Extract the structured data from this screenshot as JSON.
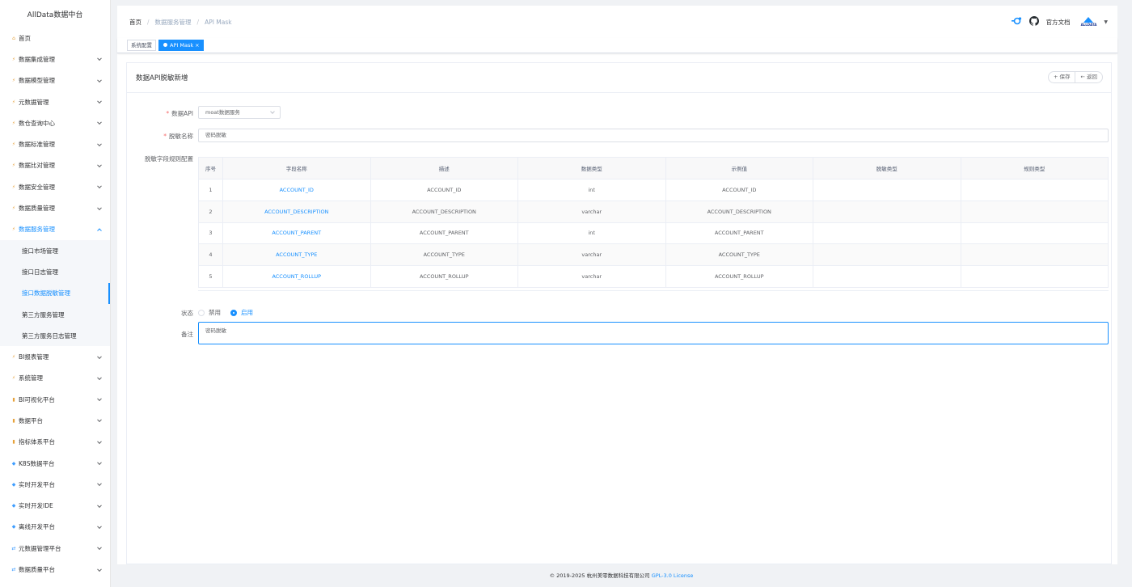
{
  "app_title": "AllData数据中台",
  "sidebar": {
    "items": [
      {
        "label": "首页",
        "icon": "home-icon",
        "expandable": false
      },
      {
        "label": "数据集成管理",
        "icon": "bolt-icon",
        "expandable": true
      },
      {
        "label": "数据模型管理",
        "icon": "bolt-icon",
        "expandable": true
      },
      {
        "label": "元数据管理",
        "icon": "bolt-icon",
        "expandable": true
      },
      {
        "label": "数仓查询中心",
        "icon": "bolt-icon",
        "expandable": true
      },
      {
        "label": "数据标准管理",
        "icon": "bolt-icon",
        "expandable": true
      },
      {
        "label": "数据比对管理",
        "icon": "bolt-icon",
        "expandable": true
      },
      {
        "label": "数据安全管理",
        "icon": "bolt-icon",
        "expandable": true
      },
      {
        "label": "数据质量管理",
        "icon": "bolt-icon",
        "expandable": true
      },
      {
        "label": "数据服务管理",
        "icon": "bolt-icon",
        "expandable": true,
        "open": true
      },
      {
        "label": "BI报表管理",
        "icon": "bolt-icon",
        "expandable": true
      },
      {
        "label": "系统管理",
        "icon": "bolt-icon",
        "expandable": true
      },
      {
        "label": "BI可视化平台",
        "icon": "chart-icon",
        "expandable": true
      },
      {
        "label": "数据平台",
        "icon": "chart-icon",
        "expandable": true
      },
      {
        "label": "指标体系平台",
        "icon": "chart-icon",
        "expandable": true
      },
      {
        "label": "K8S数据平台",
        "icon": "diamond-icon",
        "expandable": true
      },
      {
        "label": "实时开发平台",
        "icon": "diamond-icon",
        "expandable": true
      },
      {
        "label": "实时开发IDE",
        "icon": "diamond-icon",
        "expandable": true
      },
      {
        "label": "离线开发平台",
        "icon": "diamond-icon",
        "expandable": true
      },
      {
        "label": "元数据管理平台",
        "icon": "sync-icon",
        "expandable": true
      },
      {
        "label": "数据质量平台",
        "icon": "sync-icon",
        "expandable": true
      }
    ],
    "sub_items": [
      "接口市场管理",
      "接口日志管理",
      "接口数据脱敏管理",
      "第三方服务管理",
      "第三方服务日志管理"
    ],
    "active_sub": "接口数据脱敏管理"
  },
  "breadcrumb": [
    "首页",
    "数据服务管理",
    "API Mask"
  ],
  "header_right": {
    "docs_label": "官方文档",
    "brand": "ALLDATA"
  },
  "tags": [
    "系统配置",
    "API Mask"
  ],
  "form": {
    "title": "数据API脱敏新增",
    "save_label": "保存",
    "back_label": "返回",
    "api_label": "数据API",
    "api_value": "moat数据服务",
    "name_label": "脱敏名称",
    "name_value": "密码脱敏",
    "rules_label": "脱敏字段规则配置",
    "status_label": "状态",
    "status_options": [
      "禁用",
      "启用"
    ],
    "status_selected": "启用",
    "remark_label": "备注",
    "remark_value": "密码脱敏"
  },
  "table": {
    "columns": [
      "序号",
      "字段名称",
      "描述",
      "数据类型",
      "示例值",
      "脱敏类型",
      "规则类型"
    ],
    "rows": [
      [
        "1",
        "ACCOUNT_ID",
        "ACCOUNT_ID",
        "int",
        "ACCOUNT_ID",
        "",
        ""
      ],
      [
        "2",
        "ACCOUNT_DESCRIPTION",
        "ACCOUNT_DESCRIPTION",
        "varchar",
        "ACCOUNT_DESCRIPTION",
        "",
        ""
      ],
      [
        "3",
        "ACCOUNT_PARENT",
        "ACCOUNT_PARENT",
        "int",
        "ACCOUNT_PARENT",
        "",
        ""
      ],
      [
        "4",
        "ACCOUNT_TYPE",
        "ACCOUNT_TYPE",
        "varchar",
        "ACCOUNT_TYPE",
        "",
        ""
      ],
      [
        "5",
        "ACCOUNT_ROLLUP",
        "ACCOUNT_ROLLUP",
        "varchar",
        "ACCOUNT_ROLLUP",
        "",
        ""
      ]
    ]
  },
  "footer": {
    "text": "© 2019-2025 杭州美零数据科技有限公司",
    "license": "GPL-3.0 License"
  },
  "colors": {
    "accent": "#1890ff",
    "required": "#f56c6c"
  }
}
